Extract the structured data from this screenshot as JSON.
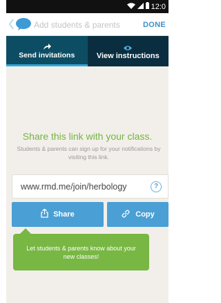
{
  "status_bar": {
    "time": "12:0",
    "icons": [
      "wifi-icon",
      "signal-icon",
      "battery-icon"
    ]
  },
  "header": {
    "back_icon": "chevron-left-icon",
    "logo_icon": "remind-cloud-logo",
    "title": "Add students & parents",
    "done_label": "DONE"
  },
  "tabs": [
    {
      "label": "Send invitations",
      "icon": "send-arrow-icon",
      "active": true
    },
    {
      "label": "View instructions",
      "icon": "eye-icon",
      "active": false
    }
  ],
  "main": {
    "title": "Share this link with your class.",
    "description": "Students & parents can sign up for your notifications by visiting this link.",
    "link": "www.rmd.me/join/herbology",
    "help_label": "?",
    "share_label": "Share",
    "copy_label": "Copy",
    "tooltip": "Let students & parents know about your new classes!"
  },
  "colors": {
    "accent_blue": "#4a9fd5",
    "tab_bar": "#0d3d52",
    "active_underline": "#33a8dd",
    "green": "#78b743",
    "title_green": "#74b441",
    "background": "#f2efea"
  }
}
